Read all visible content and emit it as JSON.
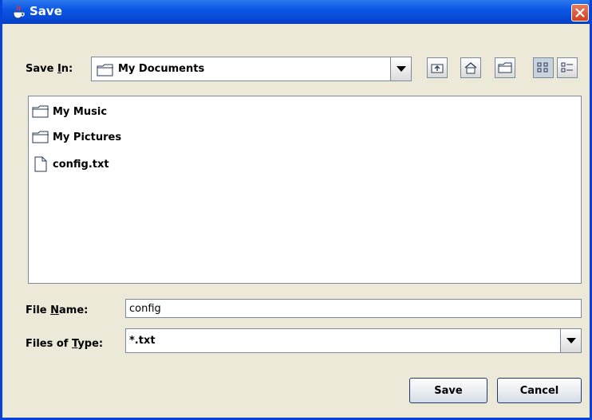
{
  "window": {
    "title": "Save"
  },
  "save_in": {
    "label_pre": "Save ",
    "label_mnemonic": "I",
    "label_post": "n:",
    "value": "My Documents"
  },
  "toolbar": {
    "up_icon": "up-one-level-icon",
    "home_icon": "home-icon",
    "new_folder_icon": "new-folder-icon",
    "list_icon": "list-view-icon",
    "details_icon": "details-view-icon"
  },
  "files": [
    {
      "name": "My Music",
      "type": "folder"
    },
    {
      "name": "My Pictures",
      "type": "folder"
    },
    {
      "name": "config.txt",
      "type": "file"
    }
  ],
  "file_name": {
    "label_pre": "File ",
    "label_mnemonic": "N",
    "label_post": "ame:",
    "value": "config"
  },
  "file_type": {
    "label_pre": "Files of ",
    "label_mnemonic": "T",
    "label_post": "ype:",
    "value": "*.txt"
  },
  "buttons": {
    "save": "Save",
    "cancel": "Cancel"
  }
}
